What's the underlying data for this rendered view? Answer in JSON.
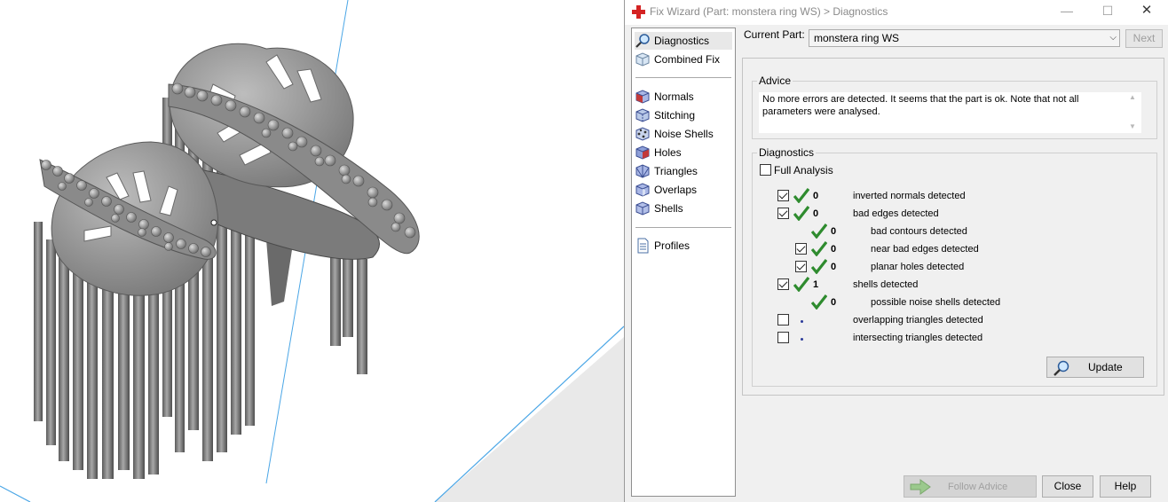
{
  "window": {
    "title": "Fix Wizard (Part: monstera ring WS) > Diagnostics",
    "min_glyph": "—",
    "max_glyph": "☐",
    "close_glyph": "✕"
  },
  "nav": {
    "items": [
      {
        "label": "Diagnostics",
        "icon": "magnifier-icon",
        "active": true
      },
      {
        "label": "Combined Fix",
        "icon": "cube-icon"
      },
      {
        "label": "Normals",
        "icon": "normals-cube-icon"
      },
      {
        "label": "Stitching",
        "icon": "stitching-cube-icon"
      },
      {
        "label": "Noise Shells",
        "icon": "noise-shells-icon"
      },
      {
        "label": "Holes",
        "icon": "holes-cube-icon"
      },
      {
        "label": "Triangles",
        "icon": "triangles-cube-icon"
      },
      {
        "label": "Overlaps",
        "icon": "overlaps-cube-icon"
      },
      {
        "label": "Shells",
        "icon": "shells-cube-icon"
      },
      {
        "label": "Profiles",
        "icon": "document-icon"
      }
    ]
  },
  "current_part": {
    "label": "Current Part:",
    "value": "monstera ring WS",
    "next_label": "Next"
  },
  "advice": {
    "caption": "Advice",
    "text": "No more errors are detected. It seems that the part is ok. Note that not all parameters were analysed."
  },
  "diagnostics": {
    "caption": "Diagnostics",
    "full_analysis_label": "Full Analysis",
    "full_analysis_checked": false,
    "rows": [
      {
        "count": "0",
        "label": "inverted normals detected",
        "checked": true,
        "ok": true
      },
      {
        "count": "0",
        "label": "bad edges detected",
        "checked": true,
        "ok": true
      },
      {
        "count": "0",
        "label": "bad contours detected",
        "ok": true
      },
      {
        "count": "0",
        "label": "near bad edges detected",
        "checked": true,
        "ok": true
      },
      {
        "count": "0",
        "label": "planar holes detected",
        "checked": true,
        "ok": true
      },
      {
        "count": "1",
        "label": "shells detected",
        "checked": true,
        "ok": true
      },
      {
        "count": "0",
        "label": "possible noise shells detected",
        "ok": true
      },
      {
        "count": "",
        "label": "overlapping triangles detected",
        "checked": false,
        "ok": false
      },
      {
        "count": "",
        "label": "intersecting triangles detected",
        "checked": false,
        "ok": false
      }
    ],
    "update_label": "Update"
  },
  "footer": {
    "follow_advice_label": "Follow Advice",
    "close_label": "Close",
    "help_label": "Help"
  },
  "colors": {
    "ok_check": "#2e8b2e",
    "accent_line": "#3aa0e0",
    "model_gray": "#7c7c7c"
  }
}
